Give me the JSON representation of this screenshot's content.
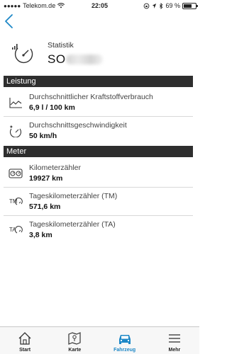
{
  "status_bar": {
    "carrier": "Telekom.de",
    "time": "22:05",
    "battery": "69 %",
    "battery_level": 0.69
  },
  "header": {
    "subtitle": "Statistik",
    "title": "SO"
  },
  "sections": {
    "leistung": {
      "title": "Leistung",
      "rows": [
        {
          "label": "Durchschnittlicher Kraftstoffverbrauch",
          "value": "6,9 l / 100 km",
          "icon": "fuel-chart-icon"
        },
        {
          "label": "Durchschnittsgeschwindigkeit",
          "value": "50 km/h",
          "icon": "speed-gauge-icon"
        }
      ]
    },
    "meter": {
      "title": "Meter",
      "rows": [
        {
          "label": "Kilometerzähler",
          "value": "19927 km",
          "icon": "odometer-icon"
        },
        {
          "label": "Tageskilometerzähler (TM)",
          "value": "571,6 km",
          "icon": "trip-tm-icon",
          "icon_text": "TM"
        },
        {
          "label": "Tageskilometerzähler (TA)",
          "value": "3,8 km",
          "icon": "trip-ta-icon",
          "icon_text": "TA"
        }
      ]
    }
  },
  "tabbar": {
    "tabs": [
      {
        "label": "Start",
        "icon": "home-icon"
      },
      {
        "label": "Karte",
        "icon": "map-icon"
      },
      {
        "label": "Fahrzeug",
        "icon": "car-icon",
        "active": true
      },
      {
        "label": "Mehr",
        "icon": "menu-icon"
      }
    ],
    "active_color": "#1e88c7"
  }
}
